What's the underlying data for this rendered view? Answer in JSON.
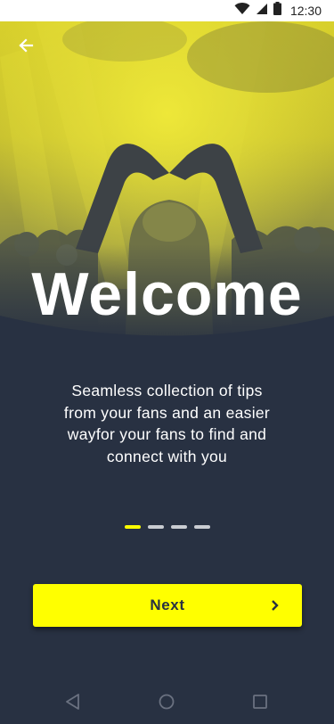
{
  "status_bar": {
    "time": "12:30",
    "icons": [
      "wifi-icon",
      "cellular-signal-icon",
      "battery-icon"
    ]
  },
  "header": {
    "back_icon": "arrow-left-icon"
  },
  "hero": {
    "title": "Welcome"
  },
  "description": {
    "lines": [
      "Seamless collection of tips",
      "from your fans and an easier",
      "wayfor your fans to find and",
      "connect with you"
    ]
  },
  "pager": {
    "total": 4,
    "active_index": 0
  },
  "next_button": {
    "label": "Next",
    "icon": "chevron-right-icon"
  },
  "nav_bar": {
    "icons": [
      "back-triangle-icon",
      "home-circle-icon",
      "recents-square-icon"
    ]
  },
  "colors": {
    "background": "#283142",
    "accent": "#ffff00",
    "text": "#ffffff"
  }
}
